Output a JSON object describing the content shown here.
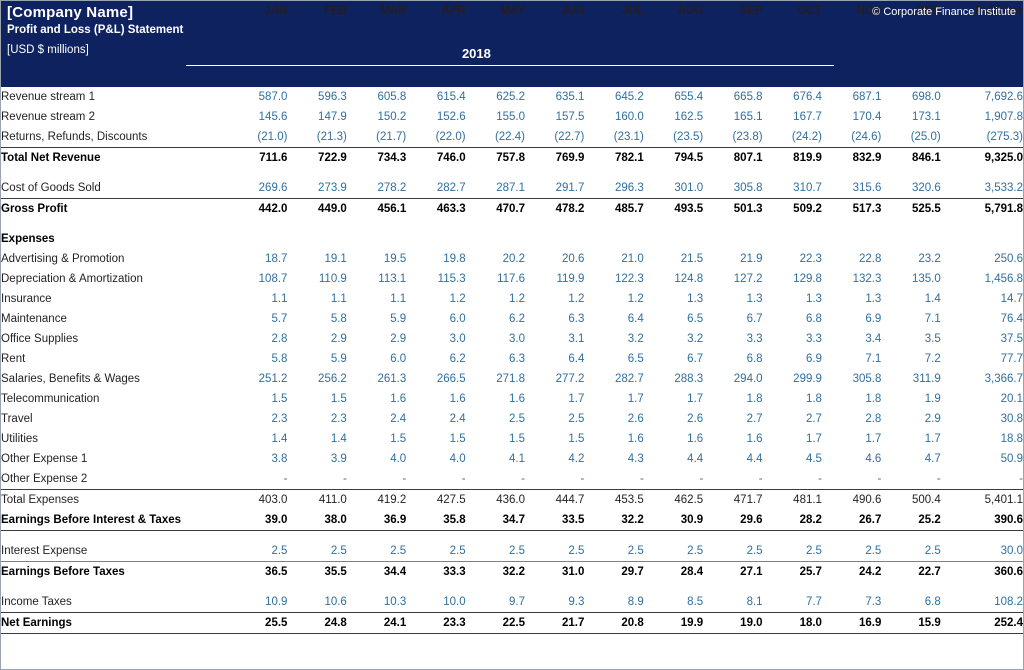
{
  "header": {
    "company": "[Company Name]",
    "statement": "Profit and Loss (P&L) Statement",
    "units": "[USD $ millions]",
    "copyright": "© Corporate Finance Institute",
    "year": "2018",
    "label_column_header": "",
    "columns": [
      "JAN",
      "FEB",
      "MAR",
      "APR",
      "MAY",
      "JUN",
      "JUL",
      "AUG",
      "SEP",
      "OCT",
      "NOV",
      "DEC",
      "Full Year"
    ]
  },
  "colors": {
    "header_background": "#0f2260",
    "header_text": "#ffffff",
    "input_value": "#2f6f9f",
    "calculated_value": "#231f20",
    "rule": "#3b3b3b"
  },
  "chart_data": {
    "type": "table",
    "title": "Profit and Loss (P&L) Statement",
    "subtitle": "[USD $ millions]",
    "period": "2018",
    "categories": [
      "JAN",
      "FEB",
      "MAR",
      "APR",
      "MAY",
      "JUN",
      "JUL",
      "AUG",
      "SEP",
      "OCT",
      "NOV",
      "DEC",
      "Full Year"
    ],
    "series": [
      {
        "name": "Revenue stream 1",
        "values": [
          "587.0",
          "596.3",
          "605.8",
          "615.4",
          "625.2",
          "635.1",
          "645.2",
          "655.4",
          "665.8",
          "676.4",
          "687.1",
          "698.0",
          "7,692.6"
        ]
      },
      {
        "name": "Revenue stream 2",
        "values": [
          "145.6",
          "147.9",
          "150.2",
          "152.6",
          "155.0",
          "157.5",
          "160.0",
          "162.5",
          "165.1",
          "167.7",
          "170.4",
          "173.1",
          "1,907.8"
        ]
      },
      {
        "name": "Returns, Refunds, Discounts",
        "values": [
          "(21.0)",
          "(21.3)",
          "(21.7)",
          "(22.0)",
          "(22.4)",
          "(22.7)",
          "(23.1)",
          "(23.5)",
          "(23.8)",
          "(24.2)",
          "(24.6)",
          "(25.0)",
          "(275.3)"
        ]
      },
      {
        "name": "Total Net Revenue",
        "values": [
          "711.6",
          "722.9",
          "734.3",
          "746.0",
          "757.8",
          "769.9",
          "782.1",
          "794.5",
          "807.1",
          "819.9",
          "832.9",
          "846.1",
          "9,325.0"
        ]
      },
      {
        "name": "Cost of Goods Sold",
        "values": [
          "269.6",
          "273.9",
          "278.2",
          "282.7",
          "287.1",
          "291.7",
          "296.3",
          "301.0",
          "305.8",
          "310.7",
          "315.6",
          "320.6",
          "3,533.2"
        ]
      },
      {
        "name": "Gross Profit",
        "values": [
          "442.0",
          "449.0",
          "456.1",
          "463.3",
          "470.7",
          "478.2",
          "485.7",
          "493.5",
          "501.3",
          "509.2",
          "517.3",
          "525.5",
          "5,791.8"
        ]
      },
      {
        "name": "Advertising & Promotion",
        "values": [
          "18.7",
          "19.1",
          "19.5",
          "19.8",
          "20.2",
          "20.6",
          "21.0",
          "21.5",
          "21.9",
          "22.3",
          "22.8",
          "23.2",
          "250.6"
        ]
      },
      {
        "name": "Depreciation & Amortization",
        "values": [
          "108.7",
          "110.9",
          "113.1",
          "115.3",
          "117.6",
          "119.9",
          "122.3",
          "124.8",
          "127.2",
          "129.8",
          "132.3",
          "135.0",
          "1,456.8"
        ]
      },
      {
        "name": "Insurance",
        "values": [
          "1.1",
          "1.1",
          "1.1",
          "1.2",
          "1.2",
          "1.2",
          "1.2",
          "1.3",
          "1.3",
          "1.3",
          "1.3",
          "1.4",
          "14.7"
        ]
      },
      {
        "name": "Maintenance",
        "values": [
          "5.7",
          "5.8",
          "5.9",
          "6.0",
          "6.2",
          "6.3",
          "6.4",
          "6.5",
          "6.7",
          "6.8",
          "6.9",
          "7.1",
          "76.4"
        ]
      },
      {
        "name": "Office Supplies",
        "values": [
          "2.8",
          "2.9",
          "2.9",
          "3.0",
          "3.0",
          "3.1",
          "3.2",
          "3.2",
          "3.3",
          "3.3",
          "3.4",
          "3.5",
          "37.5"
        ]
      },
      {
        "name": "Rent",
        "values": [
          "5.8",
          "5.9",
          "6.0",
          "6.2",
          "6.3",
          "6.4",
          "6.5",
          "6.7",
          "6.8",
          "6.9",
          "7.1",
          "7.2",
          "77.7"
        ]
      },
      {
        "name": "Salaries, Benefits & Wages",
        "values": [
          "251.2",
          "256.2",
          "261.3",
          "266.5",
          "271.8",
          "277.2",
          "282.7",
          "288.3",
          "294.0",
          "299.9",
          "305.8",
          "311.9",
          "3,366.7"
        ]
      },
      {
        "name": "Telecommunication",
        "values": [
          "1.5",
          "1.5",
          "1.6",
          "1.6",
          "1.6",
          "1.7",
          "1.7",
          "1.7",
          "1.8",
          "1.8",
          "1.8",
          "1.9",
          "20.1"
        ]
      },
      {
        "name": "Travel",
        "values": [
          "2.3",
          "2.3",
          "2.4",
          "2.4",
          "2.5",
          "2.5",
          "2.6",
          "2.6",
          "2.7",
          "2.7",
          "2.8",
          "2.9",
          "30.8"
        ]
      },
      {
        "name": "Utilities",
        "values": [
          "1.4",
          "1.4",
          "1.5",
          "1.5",
          "1.5",
          "1.5",
          "1.6",
          "1.6",
          "1.6",
          "1.7",
          "1.7",
          "1.7",
          "18.8"
        ]
      },
      {
        "name": "Other Expense 1",
        "values": [
          "3.8",
          "3.9",
          "4.0",
          "4.0",
          "4.1",
          "4.2",
          "4.3",
          "4.4",
          "4.4",
          "4.5",
          "4.6",
          "4.7",
          "50.9"
        ]
      },
      {
        "name": "Other Expense 2",
        "values": [
          "-",
          "-",
          "-",
          "-",
          "-",
          "-",
          "-",
          "-",
          "-",
          "-",
          "-",
          "-",
          "-"
        ]
      },
      {
        "name": "Total Expenses",
        "values": [
          "403.0",
          "411.0",
          "419.2",
          "427.5",
          "436.0",
          "444.7",
          "453.5",
          "462.5",
          "471.7",
          "481.1",
          "490.6",
          "500.4",
          "5,401.1"
        ]
      },
      {
        "name": "Earnings Before Interest & Taxes",
        "values": [
          "39.0",
          "38.0",
          "36.9",
          "35.8",
          "34.7",
          "33.5",
          "32.2",
          "30.9",
          "29.6",
          "28.2",
          "26.7",
          "25.2",
          "390.6"
        ]
      },
      {
        "name": "Interest Expense",
        "values": [
          "2.5",
          "2.5",
          "2.5",
          "2.5",
          "2.5",
          "2.5",
          "2.5",
          "2.5",
          "2.5",
          "2.5",
          "2.5",
          "2.5",
          "30.0"
        ]
      },
      {
        "name": "Earnings Before Taxes",
        "values": [
          "36.5",
          "35.5",
          "34.4",
          "33.3",
          "32.2",
          "31.0",
          "29.7",
          "28.4",
          "27.1",
          "25.7",
          "24.2",
          "22.7",
          "360.6"
        ]
      },
      {
        "name": "Income Taxes",
        "values": [
          "10.9",
          "10.6",
          "10.3",
          "10.0",
          "9.7",
          "9.3",
          "8.9",
          "8.5",
          "8.1",
          "7.7",
          "7.3",
          "6.8",
          "108.2"
        ]
      },
      {
        "name": "Net Earnings",
        "values": [
          "25.5",
          "24.8",
          "24.1",
          "23.3",
          "22.5",
          "21.7",
          "20.8",
          "19.9",
          "19.0",
          "18.0",
          "16.9",
          "15.9",
          "252.4"
        ]
      }
    ]
  },
  "rows": [
    {
      "id": "revenue-stream-1",
      "label": "Revenue stream 1",
      "style": "input",
      "values": [
        "587.0",
        "596.3",
        "605.8",
        "615.4",
        "625.2",
        "635.1",
        "645.2",
        "655.4",
        "665.8",
        "676.4",
        "687.1",
        "698.0",
        "7,692.6"
      ]
    },
    {
      "id": "revenue-stream-2",
      "label": "Revenue stream 2",
      "style": "input",
      "values": [
        "145.6",
        "147.9",
        "150.2",
        "152.6",
        "155.0",
        "157.5",
        "160.0",
        "162.5",
        "165.1",
        "167.7",
        "170.4",
        "173.1",
        "1,907.8"
      ]
    },
    {
      "id": "returns-refunds-discounts",
      "label": "Returns, Refunds, Discounts",
      "style": "input",
      "values": [
        "(21.0)",
        "(21.3)",
        "(21.7)",
        "(22.0)",
        "(22.4)",
        "(22.7)",
        "(23.1)",
        "(23.5)",
        "(23.8)",
        "(24.2)",
        "(24.6)",
        "(25.0)",
        "(275.3)"
      ]
    },
    {
      "id": "total-net-revenue",
      "label": "Total Net Revenue",
      "style": "total",
      "values": [
        "711.6",
        "722.9",
        "734.3",
        "746.0",
        "757.8",
        "769.9",
        "782.1",
        "794.5",
        "807.1",
        "819.9",
        "832.9",
        "846.1",
        "9,325.0"
      ]
    },
    {
      "id": "spacer-1",
      "label": "",
      "style": "spacer",
      "values": []
    },
    {
      "id": "cost-of-goods-sold",
      "label": "Cost of Goods Sold",
      "style": "input",
      "values": [
        "269.6",
        "273.9",
        "278.2",
        "282.7",
        "287.1",
        "291.7",
        "296.3",
        "301.0",
        "305.8",
        "310.7",
        "315.6",
        "320.6",
        "3,533.2"
      ]
    },
    {
      "id": "gross-profit",
      "label": "Gross Profit",
      "style": "total",
      "values": [
        "442.0",
        "449.0",
        "456.1",
        "463.3",
        "470.7",
        "478.2",
        "485.7",
        "493.5",
        "501.3",
        "509.2",
        "517.3",
        "525.5",
        "5,791.8"
      ]
    },
    {
      "id": "spacer-2",
      "label": "",
      "style": "spacer",
      "values": []
    },
    {
      "id": "expenses-heading",
      "label": "Expenses",
      "style": "section",
      "values": []
    },
    {
      "id": "advertising-promotion",
      "label": "Advertising & Promotion",
      "style": "input",
      "values": [
        "18.7",
        "19.1",
        "19.5",
        "19.8",
        "20.2",
        "20.6",
        "21.0",
        "21.5",
        "21.9",
        "22.3",
        "22.8",
        "23.2",
        "250.6"
      ]
    },
    {
      "id": "depreciation-amortization",
      "label": "Depreciation & Amortization",
      "style": "input",
      "values": [
        "108.7",
        "110.9",
        "113.1",
        "115.3",
        "117.6",
        "119.9",
        "122.3",
        "124.8",
        "127.2",
        "129.8",
        "132.3",
        "135.0",
        "1,456.8"
      ]
    },
    {
      "id": "insurance",
      "label": "Insurance",
      "style": "input",
      "values": [
        "1.1",
        "1.1",
        "1.1",
        "1.2",
        "1.2",
        "1.2",
        "1.2",
        "1.3",
        "1.3",
        "1.3",
        "1.3",
        "1.4",
        "14.7"
      ]
    },
    {
      "id": "maintenance",
      "label": "Maintenance",
      "style": "input",
      "values": [
        "5.7",
        "5.8",
        "5.9",
        "6.0",
        "6.2",
        "6.3",
        "6.4",
        "6.5",
        "6.7",
        "6.8",
        "6.9",
        "7.1",
        "76.4"
      ]
    },
    {
      "id": "office-supplies",
      "label": "Office Supplies",
      "style": "input",
      "values": [
        "2.8",
        "2.9",
        "2.9",
        "3.0",
        "3.0",
        "3.1",
        "3.2",
        "3.2",
        "3.3",
        "3.3",
        "3.4",
        "3.5",
        "37.5"
      ]
    },
    {
      "id": "rent",
      "label": "Rent",
      "style": "input",
      "values": [
        "5.8",
        "5.9",
        "6.0",
        "6.2",
        "6.3",
        "6.4",
        "6.5",
        "6.7",
        "6.8",
        "6.9",
        "7.1",
        "7.2",
        "77.7"
      ]
    },
    {
      "id": "salaries-benefits-wages",
      "label": "Salaries, Benefits & Wages",
      "style": "input",
      "values": [
        "251.2",
        "256.2",
        "261.3",
        "266.5",
        "271.8",
        "277.2",
        "282.7",
        "288.3",
        "294.0",
        "299.9",
        "305.8",
        "311.9",
        "3,366.7"
      ]
    },
    {
      "id": "telecommunication",
      "label": "Telecommunication",
      "style": "input",
      "values": [
        "1.5",
        "1.5",
        "1.6",
        "1.6",
        "1.6",
        "1.7",
        "1.7",
        "1.7",
        "1.8",
        "1.8",
        "1.8",
        "1.9",
        "20.1"
      ]
    },
    {
      "id": "travel",
      "label": "Travel",
      "style": "input",
      "values": [
        "2.3",
        "2.3",
        "2.4",
        "2.4",
        "2.5",
        "2.5",
        "2.6",
        "2.6",
        "2.7",
        "2.7",
        "2.8",
        "2.9",
        "30.8"
      ]
    },
    {
      "id": "utilities",
      "label": "Utilities",
      "style": "input",
      "values": [
        "1.4",
        "1.4",
        "1.5",
        "1.5",
        "1.5",
        "1.5",
        "1.6",
        "1.6",
        "1.6",
        "1.7",
        "1.7",
        "1.7",
        "18.8"
      ]
    },
    {
      "id": "other-expense-1",
      "label": "Other Expense 1",
      "style": "input",
      "values": [
        "3.8",
        "3.9",
        "4.0",
        "4.0",
        "4.1",
        "4.2",
        "4.3",
        "4.4",
        "4.4",
        "4.5",
        "4.6",
        "4.7",
        "50.9"
      ]
    },
    {
      "id": "other-expense-2",
      "label": "Other Expense 2",
      "style": "input",
      "values": [
        "-",
        "-",
        "-",
        "-",
        "-",
        "-",
        "-",
        "-",
        "-",
        "-",
        "-",
        "-",
        "-"
      ]
    },
    {
      "id": "total-expenses",
      "label": "Total Expenses",
      "style": "subtotal",
      "values": [
        "403.0",
        "411.0",
        "419.2",
        "427.5",
        "436.0",
        "444.7",
        "453.5",
        "462.5",
        "471.7",
        "481.1",
        "490.6",
        "500.4",
        "5,401.1"
      ]
    },
    {
      "id": "ebit",
      "label": "Earnings Before Interest & Taxes",
      "style": "total",
      "values": [
        "39.0",
        "38.0",
        "36.9",
        "35.8",
        "34.7",
        "33.5",
        "32.2",
        "30.9",
        "29.6",
        "28.2",
        "26.7",
        "25.2",
        "390.6"
      ]
    },
    {
      "id": "spacer-3",
      "label": "",
      "style": "spacer",
      "values": []
    },
    {
      "id": "interest-expense",
      "label": "Interest Expense",
      "style": "input",
      "values": [
        "2.5",
        "2.5",
        "2.5",
        "2.5",
        "2.5",
        "2.5",
        "2.5",
        "2.5",
        "2.5",
        "2.5",
        "2.5",
        "2.5",
        "30.0"
      ]
    },
    {
      "id": "earnings-before-taxes",
      "label": "Earnings Before Taxes",
      "style": "total",
      "values": [
        "36.5",
        "35.5",
        "34.4",
        "33.3",
        "32.2",
        "31.0",
        "29.7",
        "28.4",
        "27.1",
        "25.7",
        "24.2",
        "22.7",
        "360.6"
      ]
    },
    {
      "id": "spacer-4",
      "label": "",
      "style": "spacer",
      "values": []
    },
    {
      "id": "income-taxes",
      "label": "Income Taxes",
      "style": "input",
      "values": [
        "10.9",
        "10.6",
        "10.3",
        "10.0",
        "9.7",
        "9.3",
        "8.9",
        "8.5",
        "8.1",
        "7.7",
        "7.3",
        "6.8",
        "108.2"
      ]
    },
    {
      "id": "net-earnings",
      "label": "Net Earnings",
      "style": "total",
      "values": [
        "25.5",
        "24.8",
        "24.1",
        "23.3",
        "22.5",
        "21.7",
        "20.8",
        "19.9",
        "19.0",
        "18.0",
        "16.9",
        "15.9",
        "252.4"
      ]
    }
  ]
}
